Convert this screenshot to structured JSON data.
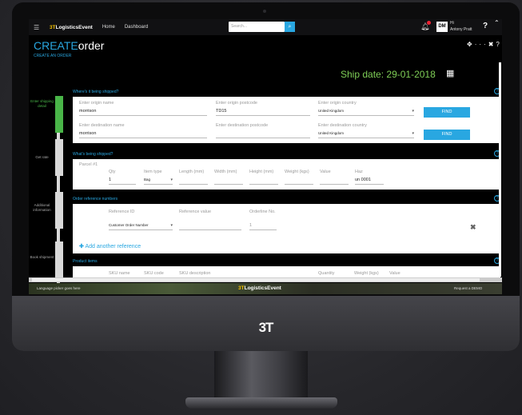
{
  "topbar": {
    "brand_prefix": "3T",
    "brand_name": "LogisticsEvent",
    "nav": [
      "Home",
      "Dashboard"
    ],
    "search_placeholder": "Search...",
    "avatar": "DM",
    "greeting": "Hi",
    "user": "Antony Pratt",
    "help": "?"
  },
  "page": {
    "title_strong": "CREATE",
    "title_rest": "order",
    "subtitle": "CREATE AN ORDER",
    "ship_date_label": "Ship date:",
    "ship_date_value": "29-01-2018"
  },
  "steps": [
    {
      "label": "Enter shipping detail",
      "active": true
    },
    {
      "label": "Get rate",
      "active": false
    },
    {
      "label": "Additional information",
      "active": false
    },
    {
      "label": "Book shipment",
      "active": false
    }
  ],
  "shipping": {
    "heading": "Where's it being shipped?",
    "origin_name_label": "Enter origin name",
    "origin_name": "morrison",
    "origin_postcode_label": "Enter origin postcode",
    "origin_postcode": "TD15",
    "origin_country_label": "Enter origin country",
    "origin_country": "United Kingdom",
    "dest_name_label": "Enter destination name",
    "dest_name": "morrison",
    "dest_postcode_label": "Enter destination postcode",
    "dest_postcode": "",
    "dest_country_label": "Enter destination country",
    "dest_country": "United Kingdom",
    "find_label": "FIND"
  },
  "parcel": {
    "heading": "What's being shipped?",
    "title": "Parcel #1",
    "columns": [
      "Qty",
      "Item type",
      "Length (mm)",
      "Width (mm)",
      "Height (mm)",
      "Weight (kgs)",
      "Value",
      "Haz"
    ],
    "qty": "1",
    "item_type": "Bag",
    "haz": "un 0001"
  },
  "reference": {
    "heading": "Order reference numbers",
    "id_label": "Reference ID",
    "value_label": "Reference value",
    "orderline_label": "Orderline No.",
    "id_value": "Customer Order Number",
    "orderline_value": "1",
    "add_label": "Add another reference"
  },
  "products": {
    "heading": "Product items",
    "columns": [
      "SKU name",
      "SKU code",
      "SKU description",
      "Quantity",
      "Weight (kgs)",
      "Value"
    ]
  },
  "footer": {
    "language": "Language picker goes here",
    "brand_prefix": "3T",
    "brand_name": "LogisticsEvent",
    "demo": "Request a DEMO"
  },
  "monitor": {
    "chin_logo": "3T"
  }
}
